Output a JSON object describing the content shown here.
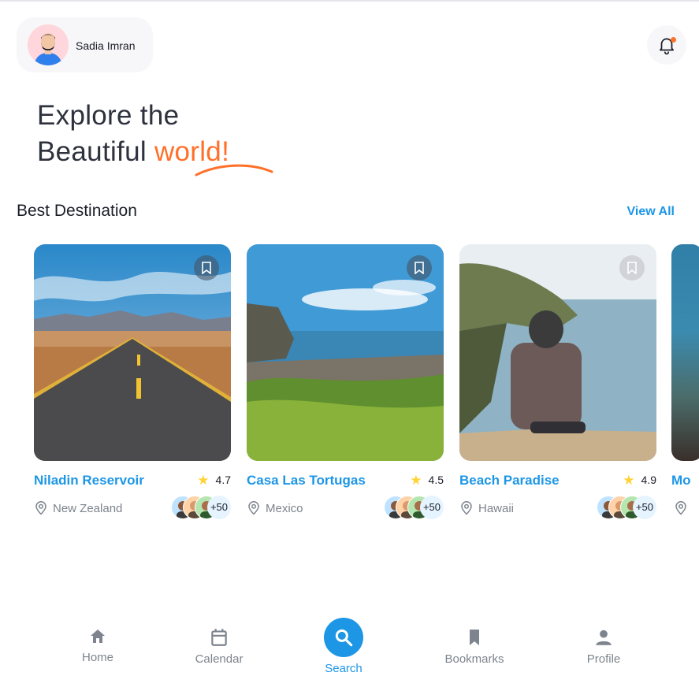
{
  "colors": {
    "accent": "#1d96e6",
    "orange": "#ff7029",
    "star": "#ffd336",
    "muted": "#7d848d"
  },
  "header": {
    "user_name": "Sadia Imran",
    "avatar_icon": "user-avatar",
    "notification_icon": "bell-icon"
  },
  "hero": {
    "line1": "Explore the",
    "line2_prefix": "Beautiful ",
    "line2_accent": "world!"
  },
  "section": {
    "title": "Best Destination",
    "view_all": "View All"
  },
  "destinations": [
    {
      "name": "Niladin Reservoir",
      "rating": "4.7",
      "location": "New Zealand",
      "visitors_more": "+50"
    },
    {
      "name": "Casa Las Tortugas",
      "rating": "4.5",
      "location": "Mexico",
      "visitors_more": "+50"
    },
    {
      "name": "Beach Paradise",
      "rating": "4.9",
      "location": "Hawaii",
      "visitors_more": "+50"
    },
    {
      "name": "Mo"
    }
  ],
  "nav": {
    "items": [
      {
        "label": "Home",
        "icon": "home-icon"
      },
      {
        "label": "Calendar",
        "icon": "calendar-icon"
      },
      {
        "label": "Search",
        "icon": "search-icon",
        "active": true
      },
      {
        "label": "Bookmarks",
        "icon": "bookmark-icon"
      },
      {
        "label": "Profile",
        "icon": "person-icon"
      }
    ]
  }
}
